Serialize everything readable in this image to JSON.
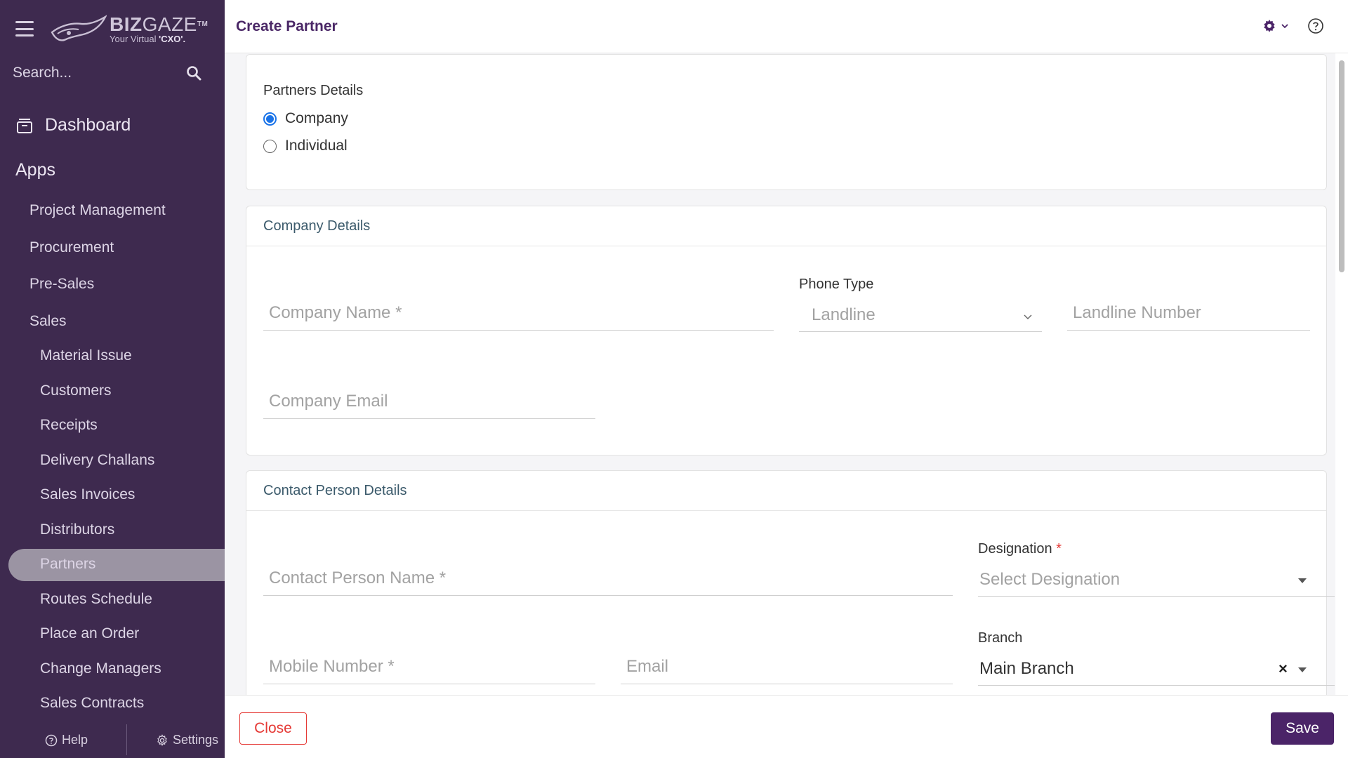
{
  "app": {
    "brand_bold": "BIZ",
    "brand_light": "GAZE",
    "brand_tm": "TM",
    "tagline_prefix": "Your Virtual ",
    "tagline_bold": "'CXO'."
  },
  "sidebar": {
    "search_placeholder": "Search...",
    "dashboard_label": "Dashboard",
    "apps_label": "Apps",
    "items": [
      {
        "label": "Project Management"
      },
      {
        "label": "Procurement"
      },
      {
        "label": "Pre-Sales"
      },
      {
        "label": "Sales"
      },
      {
        "label": "Material Issue"
      },
      {
        "label": "Customers"
      },
      {
        "label": "Receipts"
      },
      {
        "label": "Delivery Challans"
      },
      {
        "label": "Sales Invoices"
      },
      {
        "label": "Distributors"
      },
      {
        "label": "Partners",
        "active": true
      },
      {
        "label": "Routes Schedule"
      },
      {
        "label": "Place an Order"
      },
      {
        "label": "Change Managers"
      },
      {
        "label": "Sales Contracts"
      }
    ],
    "help_label": "Help",
    "settings_label": "Settings"
  },
  "header": {
    "title": "Create Partner"
  },
  "partners_details": {
    "title": "Partners Details",
    "options": [
      {
        "label": "Company",
        "selected": true
      },
      {
        "label": "Individual",
        "selected": false
      }
    ]
  },
  "company_details": {
    "title": "Company Details",
    "company_name_placeholder": "Company Name *",
    "phone_type_label": "Phone Type",
    "phone_type_value": "Landline",
    "landline_placeholder": "Landline Number",
    "company_email_placeholder": "Company Email"
  },
  "contact_details": {
    "title": "Contact Person Details",
    "contact_name_placeholder": "Contact Person Name *",
    "designation_label": "Designation",
    "designation_required": "*",
    "designation_placeholder": "Select Designation",
    "mobile_placeholder": "Mobile Number *",
    "email_placeholder": "Email",
    "branch_label": "Branch",
    "branch_value": "Main Branch",
    "clear_symbol": "×"
  },
  "footer": {
    "close_label": "Close",
    "save_label": "Save"
  },
  "colors": {
    "sidebar_bg": "#3e2a4f",
    "accent": "#4b2468",
    "danger": "#e53935",
    "radio_blue": "#1a73e8"
  }
}
